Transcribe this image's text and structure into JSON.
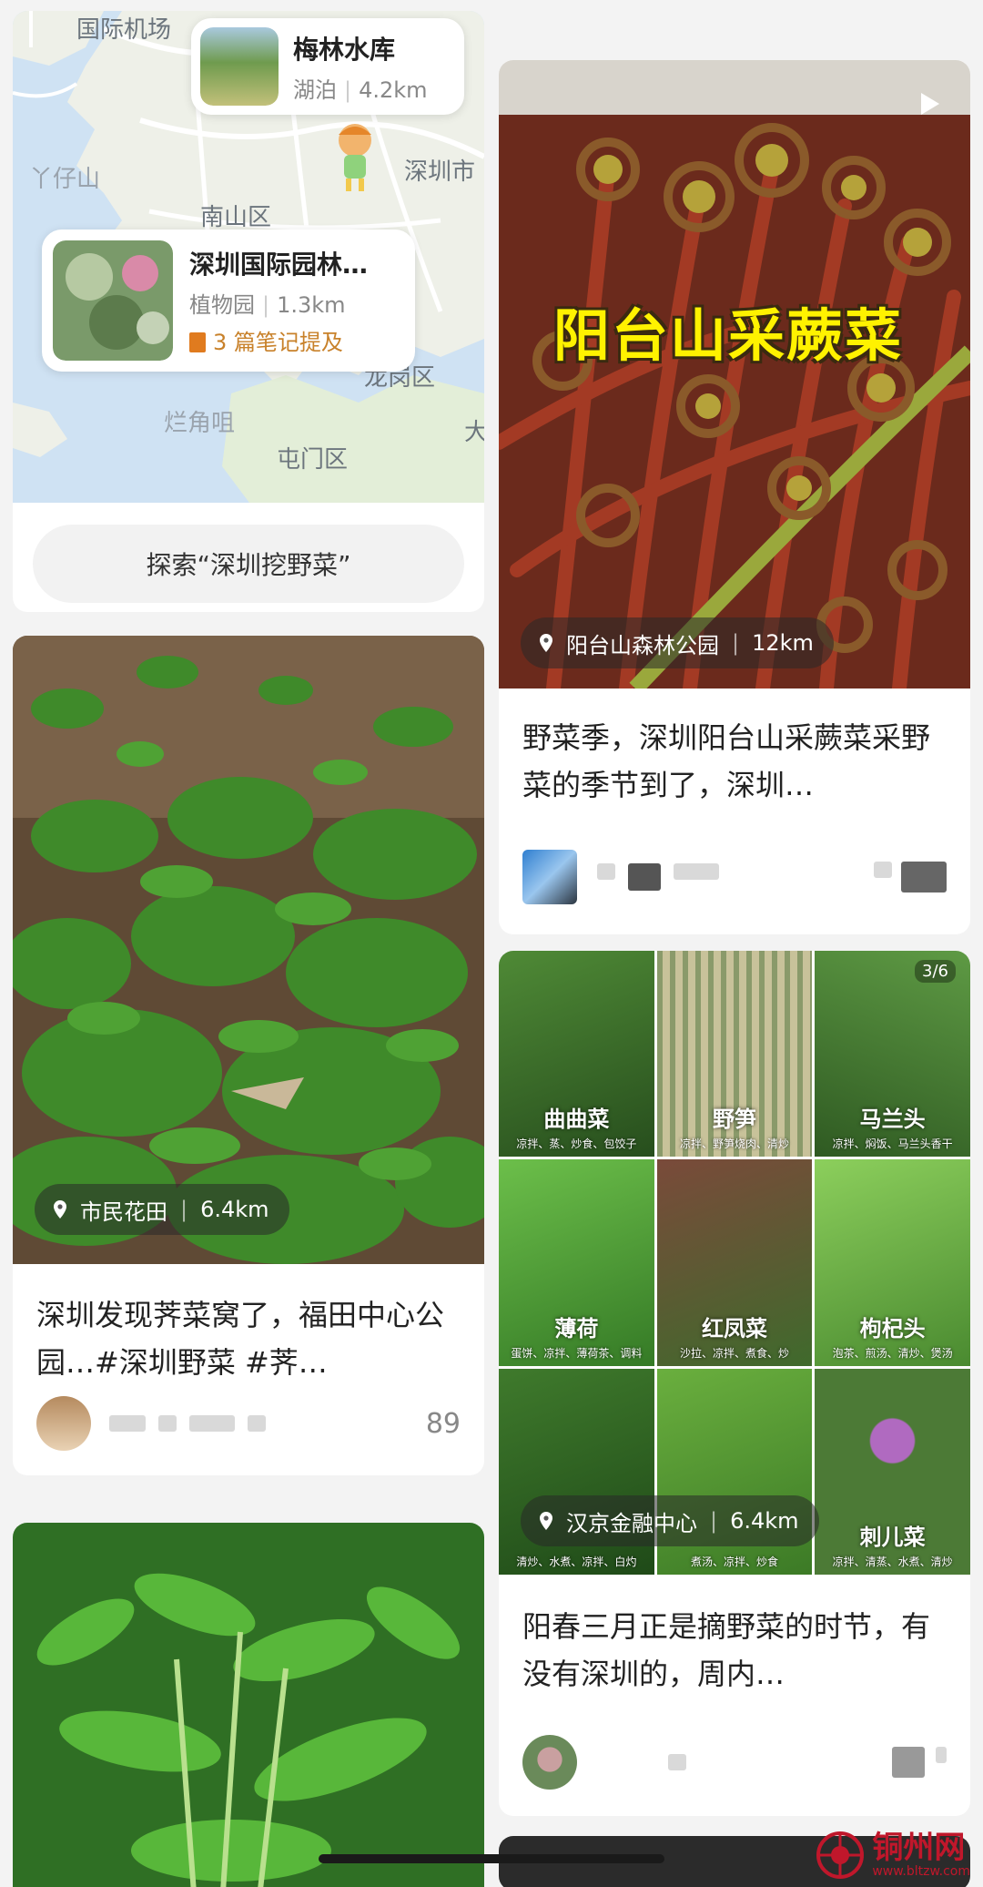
{
  "map_card": {
    "map_labels": {
      "airport": "国际机场",
      "yazaishan": "丫仔山",
      "nanshan": "南山区",
      "shenzhen_city": "深圳市",
      "longgang": "龙岗区",
      "lanjiaozui": "烂角咀",
      "tuenmun": "屯门区",
      "da": "大"
    },
    "poi_reservoir": {
      "name": "梅林水库",
      "type": "湖泊",
      "distance": "4.2km"
    },
    "poi_garden": {
      "name": "深圳国际园林…",
      "type": "植物园",
      "distance": "1.3km",
      "notes": "3 篇笔记提及"
    },
    "explore_label": "探索“深圳挖野菜”"
  },
  "fern_card": {
    "overlay_title": "阳台山采蕨菜",
    "location": {
      "name": "阳台山森林公园",
      "distance": "12km"
    },
    "title": "野菜季，深圳阳台山采蕨菜采野菜的季节到了，深圳…"
  },
  "shepherd_card": {
    "location": {
      "name": "市民花田",
      "distance": "6.4km"
    },
    "title": "深圳发现荠菜窝了，福田中心公园…#深圳野菜 #荠…",
    "likes": "89"
  },
  "collage_card": {
    "page_count": "3/6",
    "cells": [
      {
        "label": "曲曲菜",
        "sub": "凉拌、蒸、炒食、包饺子"
      },
      {
        "label": "野笋",
        "sub": "凉拌、野笋烧肉、清炒"
      },
      {
        "label": "马兰头",
        "sub": "凉拌、焖饭、马兰头香干"
      },
      {
        "label": "薄荷",
        "sub": "蛋饼、凉拌、薄荷茶、调料"
      },
      {
        "label": "红凤菜",
        "sub": "沙拉、凉拌、煮食、炒"
      },
      {
        "label": "枸杞头",
        "sub": "泡茶、煎汤、清炒、煲汤"
      },
      {
        "label": "",
        "sub": "清炒、水煮、凉拌、白灼"
      },
      {
        "label": "",
        "sub": "煮汤、凉拌、炒食"
      },
      {
        "label": "刺儿菜",
        "sub": "凉拌、清蒸、水煮、清炒"
      }
    ],
    "location": {
      "name": "汉京金融中心",
      "distance": "6.4km"
    },
    "title": "阳春三月正是摘野菜的时节，有没有深圳的，周内…"
  },
  "watermark": {
    "name": "铜州网",
    "url": "www.bltzw.com"
  },
  "colors": {
    "accent_notes": "#c8812a",
    "watermark_red": "#c0172b"
  }
}
